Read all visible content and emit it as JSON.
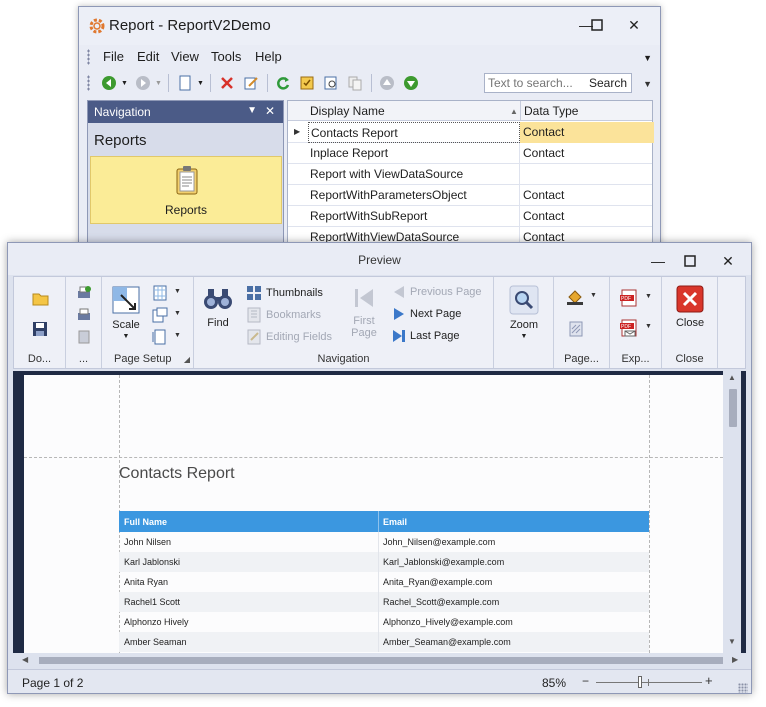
{
  "back_window": {
    "title": "Report - ReportV2Demo",
    "menu": [
      "File",
      "Edit",
      "View",
      "Tools",
      "Help"
    ],
    "search": {
      "placeholder": "Text to search...",
      "button_label": "Search"
    },
    "navigation": {
      "header": "Navigation",
      "group_title": "Reports",
      "item_label": "Reports"
    },
    "grid": {
      "columns": [
        "Display Name",
        "Data Type"
      ],
      "rows": [
        {
          "name": "Contacts Report",
          "type": "Contact",
          "selected": true
        },
        {
          "name": "Inplace Report",
          "type": "Contact"
        },
        {
          "name": "Report with ViewDataSource",
          "type": ""
        },
        {
          "name": "ReportWithParametersObject",
          "type": "Contact"
        },
        {
          "name": "ReportWithSubReport",
          "type": "Contact"
        },
        {
          "name": "ReportWithViewDataSource",
          "type": "Contact"
        }
      ]
    }
  },
  "preview_window": {
    "title": "Preview",
    "ribbon": {
      "groups": {
        "document": "Do...",
        "print": "...",
        "page_setup": "Page Setup",
        "navigation": "Navigation",
        "zoom": "",
        "page_background": "Page...",
        "export": "Exp...",
        "close": "Close"
      },
      "buttons": {
        "scale": "Scale",
        "find": "Find",
        "thumbnails": "Thumbnails",
        "bookmarks": "Bookmarks",
        "editing_fields": "Editing Fields",
        "first_page_line1": "First",
        "first_page_line2": "Page",
        "previous_page": "Previous Page",
        "next_page": "Next Page",
        "last_page": "Last Page",
        "zoom": "Zoom",
        "close": "Close"
      }
    },
    "report": {
      "title": "Contacts Report",
      "columns": [
        "Full Name",
        "Email"
      ],
      "rows": [
        {
          "name": "John Nilsen",
          "email": "John_Nilsen@example.com"
        },
        {
          "name": "Karl Jablonski",
          "email": "Karl_Jablonski@example.com"
        },
        {
          "name": "Anita Ryan",
          "email": "Anita_Ryan@example.com"
        },
        {
          "name": "Rachel1 Scott",
          "email": "Rachel_Scott@example.com"
        },
        {
          "name": "Alphonzo Hively",
          "email": "Alphonzo_Hively@example.com"
        },
        {
          "name": "Amber Seaman",
          "email": "Amber_Seaman@example.com"
        }
      ]
    },
    "status": {
      "page": "Page 1 of 2",
      "zoom": "85%"
    }
  },
  "colors": {
    "accent_header": "#3b97e0",
    "selection_yellow": "#fbec97",
    "nav_header": "#4b5b87",
    "close_red": "#d9362b"
  },
  "icons": [
    "app-gear-icon",
    "back-icon",
    "forward-icon",
    "new-icon",
    "delete-icon",
    "edit-icon",
    "refresh-icon",
    "open-icon",
    "save-icon",
    "print-icon",
    "scale-icon",
    "binoculars-icon",
    "zoom-icon",
    "pdf-icon",
    "close-icon"
  ]
}
